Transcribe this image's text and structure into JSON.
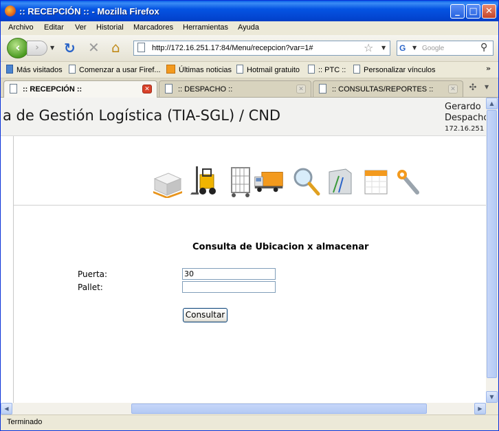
{
  "window": {
    "title": ":: RECEPCIÓN :: - Mozilla Firefox"
  },
  "menu": {
    "items": [
      "Archivo",
      "Editar",
      "Ver",
      "Historial",
      "Marcadores",
      "Herramientas",
      "Ayuda"
    ]
  },
  "navbar": {
    "url": "http://172.16.251.17:84/Menu/recepcion?var=1#",
    "search_placeholder": "Google"
  },
  "bookmarks": {
    "items": [
      "Más visitados",
      "Comenzar a usar Firef...",
      "Últimas noticias",
      "Hotmail gratuito",
      ":: PTC ::",
      "Personalizar vínculos"
    ],
    "more": "»"
  },
  "tabs": {
    "items": [
      ":: RECEPCIÓN ::",
      ":: DESPACHO ::",
      ":: CONSULTAS/REPORTES ::"
    ],
    "active_index": 0
  },
  "page": {
    "app_title": "a de Gestión Logística (TIA-SGL) / CND",
    "user_name": "Gerardo",
    "user_role": "Despacho",
    "user_ip": "172.16.251",
    "module_icons": [
      "pallet-icon",
      "forklift-icon",
      "cage-cart-icon",
      "truck-icon",
      "magnifier-icon",
      "folder-icon",
      "calendar-icon",
      "wrench-icon"
    ],
    "form": {
      "heading": "Consulta de Ubicacion x almacenar",
      "puerta_label": "Puerta:",
      "puerta_value": "30",
      "pallet_label": "Pallet:",
      "pallet_value": "",
      "submit_label": "Consultar"
    }
  },
  "status": {
    "text": "Terminado"
  },
  "colors": {
    "titlebar": "#0554e3",
    "chrome": "#ece9d8"
  }
}
